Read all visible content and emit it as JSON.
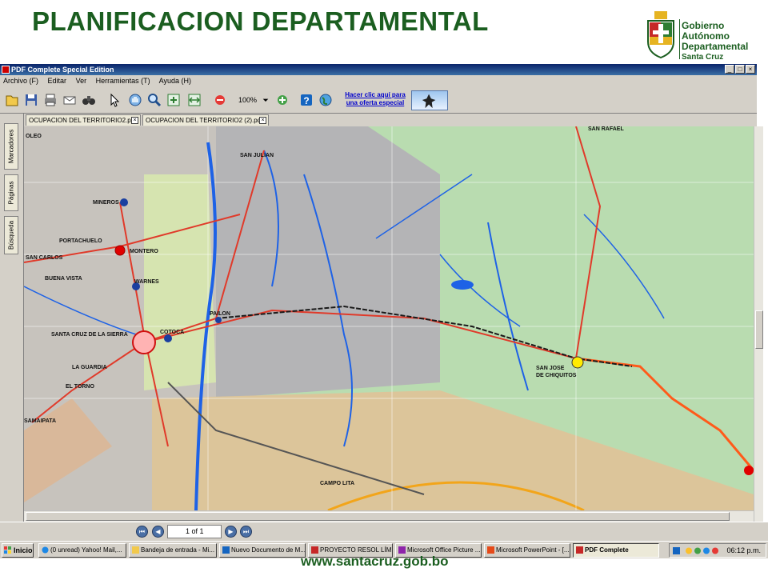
{
  "slide": {
    "title": "PLANIFICACION DEPARTAMENTAL",
    "footer_url": "www.santacruz.gob.bo",
    "logo": {
      "line1": "Gobierno",
      "line2": "Autónomo",
      "line3": "Departamental",
      "line4": "Santa Cruz"
    }
  },
  "window": {
    "title": "PDF Complete Special Edition",
    "buttons": {
      "minimize": "_",
      "maximize": "□",
      "close": "×"
    }
  },
  "menu": [
    "Archivo (F)",
    "Editar",
    "Ver",
    "Herramientas (T)",
    "Ayuda (H)"
  ],
  "toolbar": {
    "zoom": "100%",
    "offer_line1": "Hacer clic aquí para",
    "offer_line2": "una oferta especial",
    "icons": [
      "open-icon",
      "save-icon",
      "print-icon",
      "email-icon",
      "binoculars-icon",
      "select-arrow-icon",
      "hand-icon",
      "zoom-icon",
      "fit-page-icon",
      "fit-width-icon",
      "zoom-out-icon",
      "zoom-in-icon",
      "help-icon",
      "globe-icon"
    ]
  },
  "tabs": [
    {
      "label": "OCUPACION DEL TERRITORIO2.pdf"
    },
    {
      "label": "OCUPACION DEL TERRITORIO2 (2).pdf"
    }
  ],
  "side_tabs": [
    "Marcadores",
    "Páginas",
    "Búsqueda"
  ],
  "map": {
    "places": [
      "SAN RAFAEL",
      "SAN JULIAN",
      "MINEROS",
      "PORTACHUELO",
      "MONTERO",
      "SAN CARLOS",
      "BUENA VISTA",
      "WARNES",
      "PAILON",
      "COTOCA",
      "SANTA CRUZ DE LA SIERRA",
      "LA GUARDIA",
      "EL TORNO",
      "SAN JOSE",
      "DE CHIQUITOS",
      "SAMAIPATA",
      "CAMPO LITA",
      "OLEO"
    ],
    "colors": {
      "green_zone": "#b9dcb0",
      "gray_zone": "#b4b4b6",
      "tan_zone": "#dcc59a",
      "river": "#1e62e6",
      "road": "#e03a2a",
      "rail": "#1a1a1a"
    }
  },
  "status": {
    "page": "1 of 1"
  },
  "taskbar": {
    "start": "Inicio",
    "items": [
      "(0 unread) Yahoo! Mail,...",
      "Bandeja de entrada - Mi...",
      "Nuevo Documento de M...",
      "PROYECTO RESOL LÍMI...",
      "Microsoft Office Picture ...",
      "Microsoft PowerPoint - [...",
      "PDF Complete"
    ],
    "clock": "06:12 p.m."
  }
}
